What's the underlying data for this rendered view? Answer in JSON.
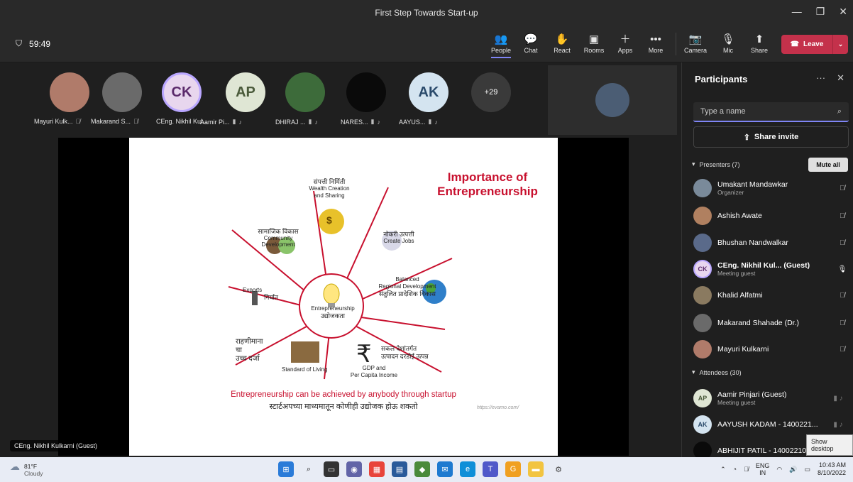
{
  "window": {
    "title": "First Step Towards Start-up"
  },
  "toolbar": {
    "timer": "59:49",
    "buttons": [
      {
        "label": "People",
        "icon": "people-icon"
      },
      {
        "label": "Chat",
        "icon": "chat-icon"
      },
      {
        "label": "React",
        "icon": "react-icon"
      },
      {
        "label": "Rooms",
        "icon": "rooms-icon"
      },
      {
        "label": "Apps",
        "icon": "apps-icon"
      },
      {
        "label": "More",
        "icon": "more-icon"
      },
      {
        "label": "Camera",
        "icon": "camera-off-icon"
      },
      {
        "label": "Mic",
        "icon": "mic-off-icon"
      },
      {
        "label": "Share",
        "icon": "share-icon"
      }
    ],
    "leave_label": "Leave",
    "accent": "#c4314b"
  },
  "strip": {
    "tiles": [
      {
        "name": "Mayuri Kulk...",
        "initials": "",
        "color": "#b07b6a"
      },
      {
        "name": "Makarand S...",
        "initials": "",
        "color": "#6a6a6a"
      },
      {
        "name": "CEng. Nikhil Kul...",
        "initials": "CK",
        "color": "#e8d6ee"
      },
      {
        "name": "Aamir Pi...",
        "initials": "AP",
        "color": "#dfe6d4"
      },
      {
        "name": "DHIRAJ ...",
        "initials": "",
        "color": "#3d6b3a"
      },
      {
        "name": "NARES...",
        "initials": "",
        "color": "#0a0a0a"
      },
      {
        "name": "AAYUS...",
        "initials": "AK",
        "color": "#d4e4f0"
      }
    ],
    "overflow": "+29"
  },
  "slide": {
    "title_line1": "Importance of",
    "title_line2": "Entrepreneurship",
    "center_en": "Entrepreneurship",
    "center_mr": "उद्योजकता",
    "wealth_mr": "संपत्ती निर्मिती",
    "wealth_en1": "Wealth Creation",
    "wealth_en2": "and Sharing",
    "jobs_mr": "नोकरी उत्पत्ती",
    "jobs_en": "Create Jobs",
    "community_mr": "सामाजिक विकास",
    "community_en1": "Community",
    "community_en2": "Development",
    "balanced_en1": "Balanced",
    "balanced_en2": "Regional Development",
    "balanced_mr": "संतुलित प्रादेशिक विकास",
    "exports_en": "Exports",
    "exports_mr": "निर्यात",
    "living_mr1": "राहणीमाना",
    "living_mr2": "चा",
    "living_mr3": "उच्च दर्जा",
    "living_en": "Standard of Living",
    "gdp_mr1": "सकल देशांतर्गत",
    "gdp_mr2": "उत्पादन दरडोई उत्पन्न",
    "gdp_en1": "GDP and",
    "gdp_en2": "Per Capita Income",
    "footer_en": "Entrepreneurship can be achieved  by anybody through startup",
    "footer_mr": "स्टार्टअपच्या माध्यमातून कोणीही उद्योजक होऊ शकतो",
    "source": "https://evamo.com/",
    "money_label": "$",
    "rupee": "₹"
  },
  "stage": {
    "presenter_tag": "CEng. Nikhil Kulkarni (Guest)"
  },
  "panel": {
    "title": "Participants",
    "search_placeholder": "Type a name",
    "share_invite": "Share invite",
    "presenters_label": "Presenters (7)",
    "mute_all": "Mute all",
    "presenters": [
      {
        "name": "Umakant Mandawkar",
        "sub": "Organizer",
        "initials": "",
        "color": "#7a8a9a",
        "status": "mic-off-icon"
      },
      {
        "name": "Ashish Awate",
        "sub": "",
        "initials": "",
        "color": "#b08060",
        "status": "mic-off-icon"
      },
      {
        "name": "Bhushan Nandwalkar",
        "sub": "",
        "initials": "",
        "color": "#5a6a8a",
        "status": "mic-off-icon"
      },
      {
        "name": "CEng. Nikhil Kul... (Guest)",
        "sub": "Meeting guest",
        "initials": "CK",
        "color": "#e8d6ee",
        "status": "mic-on-icon"
      },
      {
        "name": "Khalid Alfatmi",
        "sub": "",
        "initials": "",
        "color": "#8a7a60",
        "status": "mic-off-icon"
      },
      {
        "name": "Makarand Shahade (Dr.)",
        "sub": "",
        "initials": "",
        "color": "#6a6a6a",
        "status": "mic-off-icon"
      },
      {
        "name": "Mayuri Kulkarni",
        "sub": "",
        "initials": "",
        "color": "#b07b6a",
        "status": "mic-off-icon"
      }
    ],
    "attendees_label": "Attendees (30)",
    "attendees": [
      {
        "name": "Aamir Pinjari (Guest)",
        "sub": "Meeting guest",
        "initials": "AP",
        "color": "#dfe6d4"
      },
      {
        "name": "AAYUSH KADAM - 1400221...",
        "sub": "",
        "initials": "AK",
        "color": "#d4e4f0"
      },
      {
        "name": "ABHIJIT PATIL - 1400221003...",
        "sub": "",
        "initials": "",
        "color": "#0a0a0a"
      }
    ],
    "tooltip": "Show desktop"
  },
  "taskbar": {
    "temp": "81°F",
    "weather": "Cloudy",
    "lang1": "ENG",
    "lang2": "IN",
    "time": "10:43 AM",
    "date": "8/10/2022"
  }
}
